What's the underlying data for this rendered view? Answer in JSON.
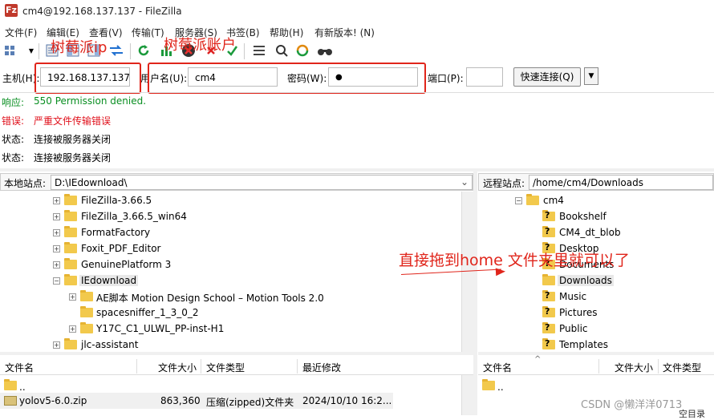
{
  "window": {
    "title": "cm4@192.168.137.137 - FileZilla",
    "app_icon": "Fz"
  },
  "menu": [
    "文件(F)",
    "编辑(E)",
    "查看(V)",
    "传输(T)",
    "服务器(S)",
    "书签(B)",
    "帮助(H)",
    "有新版本! (N)"
  ],
  "toolbar_icons": [
    "site-manager-icon",
    "toggle-log-icon",
    "toggle-local-tree-icon",
    "toggle-remote-tree-icon",
    "toggle-queue-icon",
    "refresh-icon",
    "process-queue-icon",
    "cancel-icon",
    "disconnect-icon",
    "reconnect-icon",
    "compare-icon",
    "filter-icon",
    "sync-browse-icon",
    "search-icon"
  ],
  "quickconnect": {
    "host_label": "主机(H):",
    "host_value": "192.168.137.137",
    "user_label": "用户名(U):",
    "user_value": "cm4",
    "pass_label": "密码(W):",
    "pass_value": "●",
    "port_label": "端口(P):",
    "port_value": "",
    "connect_label": "快速连接(Q)",
    "dropdown": "▼"
  },
  "annotations": {
    "host": "树莓派ip",
    "user": "树莓派账户",
    "drag": "直接拖到home 文件夹里就可以了",
    "color": "#e0251b"
  },
  "log": [
    {
      "key": "响应:",
      "msg": "550 Permission denied.",
      "color": "#0a8f22"
    },
    {
      "key": "错误:",
      "msg": "严重文件传输错误",
      "color": "#e0101b"
    },
    {
      "key": "状态:",
      "msg": "连接被服务器关闭",
      "color": "#000000"
    },
    {
      "key": "状态:",
      "msg": "连接被服务器关闭",
      "color": "#000000"
    }
  ],
  "local": {
    "label": "本地站点:",
    "path": "D:\\IEdownload\\",
    "dropdown": "⌄",
    "tree": [
      {
        "name": "FileZilla-3.66.5",
        "exp": "+"
      },
      {
        "name": "FileZilla_3.66.5_win64",
        "exp": "+"
      },
      {
        "name": "FormatFactory",
        "exp": "+"
      },
      {
        "name": "Foxit_PDF_Editor",
        "exp": "+"
      },
      {
        "name": "GenuinePlatform 3",
        "exp": "+"
      },
      {
        "name": "IEdownload",
        "exp": "−"
      },
      {
        "name": "AE脚本 Motion Design School – Motion Tools 2.0",
        "exp": "+"
      },
      {
        "name": "spacesniffer_1_3_0_2",
        "exp": ""
      },
      {
        "name": "Y17C_C1_ULWL_PP-inst-H1",
        "exp": "+"
      },
      {
        "name": "jlc-assistant",
        "exp": "+"
      }
    ],
    "columns": [
      "文件名",
      "文件大小",
      "文件类型",
      "最近修改"
    ],
    "files": [
      {
        "name": "..",
        "size": "",
        "type": "",
        "modified": ""
      },
      {
        "name": "yolov5-6.0.zip",
        "size": "863,360",
        "type": "压缩(zipped)文件夹",
        "modified": "2024/10/10 16:2..."
      }
    ]
  },
  "remote": {
    "label": "远程站点:",
    "path": "/home/cm4/Downloads",
    "tree": [
      {
        "name": "cm4",
        "exp": "−",
        "unknown": false
      },
      {
        "name": "Bookshelf",
        "exp": "",
        "unknown": true
      },
      {
        "name": "CM4_dt_blob",
        "exp": "",
        "unknown": true
      },
      {
        "name": "Desktop",
        "exp": "",
        "unknown": true
      },
      {
        "name": "Documents",
        "exp": "",
        "unknown": true
      },
      {
        "name": "Downloads",
        "exp": "",
        "unknown": false
      },
      {
        "name": "Music",
        "exp": "",
        "unknown": true
      },
      {
        "name": "Pictures",
        "exp": "",
        "unknown": true
      },
      {
        "name": "Public",
        "exp": "",
        "unknown": true
      },
      {
        "name": "Templates",
        "exp": "",
        "unknown": true
      }
    ],
    "columns": [
      "文件名",
      "文件大小",
      "文件类型"
    ],
    "sort_indicator": "^",
    "files": [
      {
        "name": "..",
        "size": "",
        "type": ""
      }
    ]
  },
  "watermark": "CSDN @懒洋洋0713",
  "status_text": "空目录"
}
